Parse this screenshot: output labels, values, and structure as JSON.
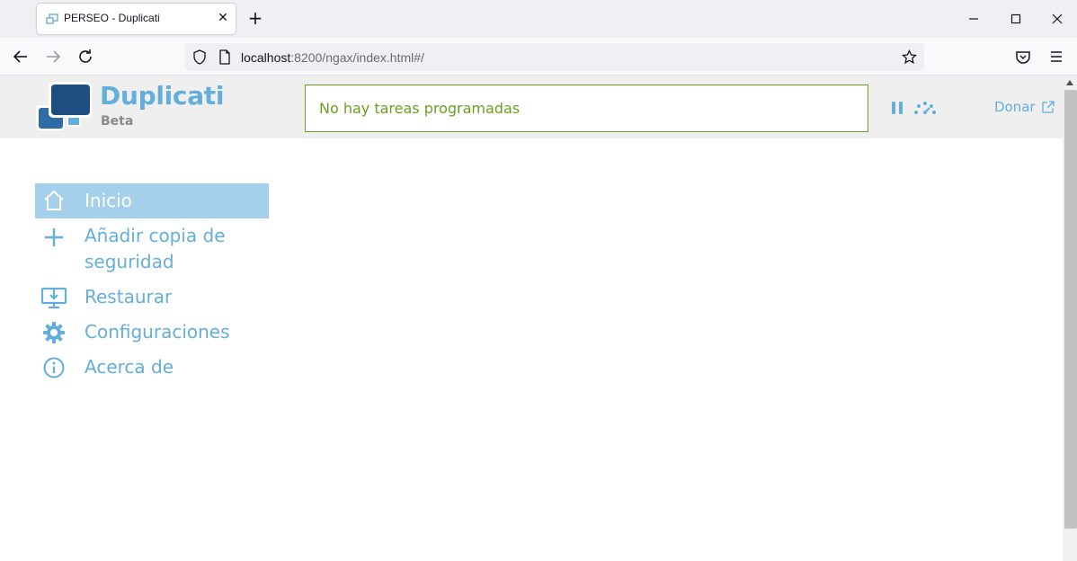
{
  "browser": {
    "tab_title": "PERSEO - Duplicati",
    "url_host": "localhost",
    "url_rest": ":8200/ngax/index.html#/"
  },
  "app": {
    "brand": "Duplicati",
    "brand_sub": "Beta",
    "status": "No hay tareas programadas",
    "donate": "Donar"
  },
  "menu": {
    "items": [
      {
        "label": "Inicio",
        "icon": "home-icon",
        "active": true
      },
      {
        "label": "Añadir copia de seguridad",
        "icon": "plus-icon",
        "active": false
      },
      {
        "label": "Restaurar",
        "icon": "restore-icon",
        "active": false
      },
      {
        "label": "Configuraciones",
        "icon": "gear-icon",
        "active": false
      },
      {
        "label": "Acerca de",
        "icon": "info-icon",
        "active": false
      }
    ]
  },
  "colors": {
    "accent": "#63aedb",
    "active_bg": "#a4d0ec",
    "status_green": "#6b9f24"
  }
}
